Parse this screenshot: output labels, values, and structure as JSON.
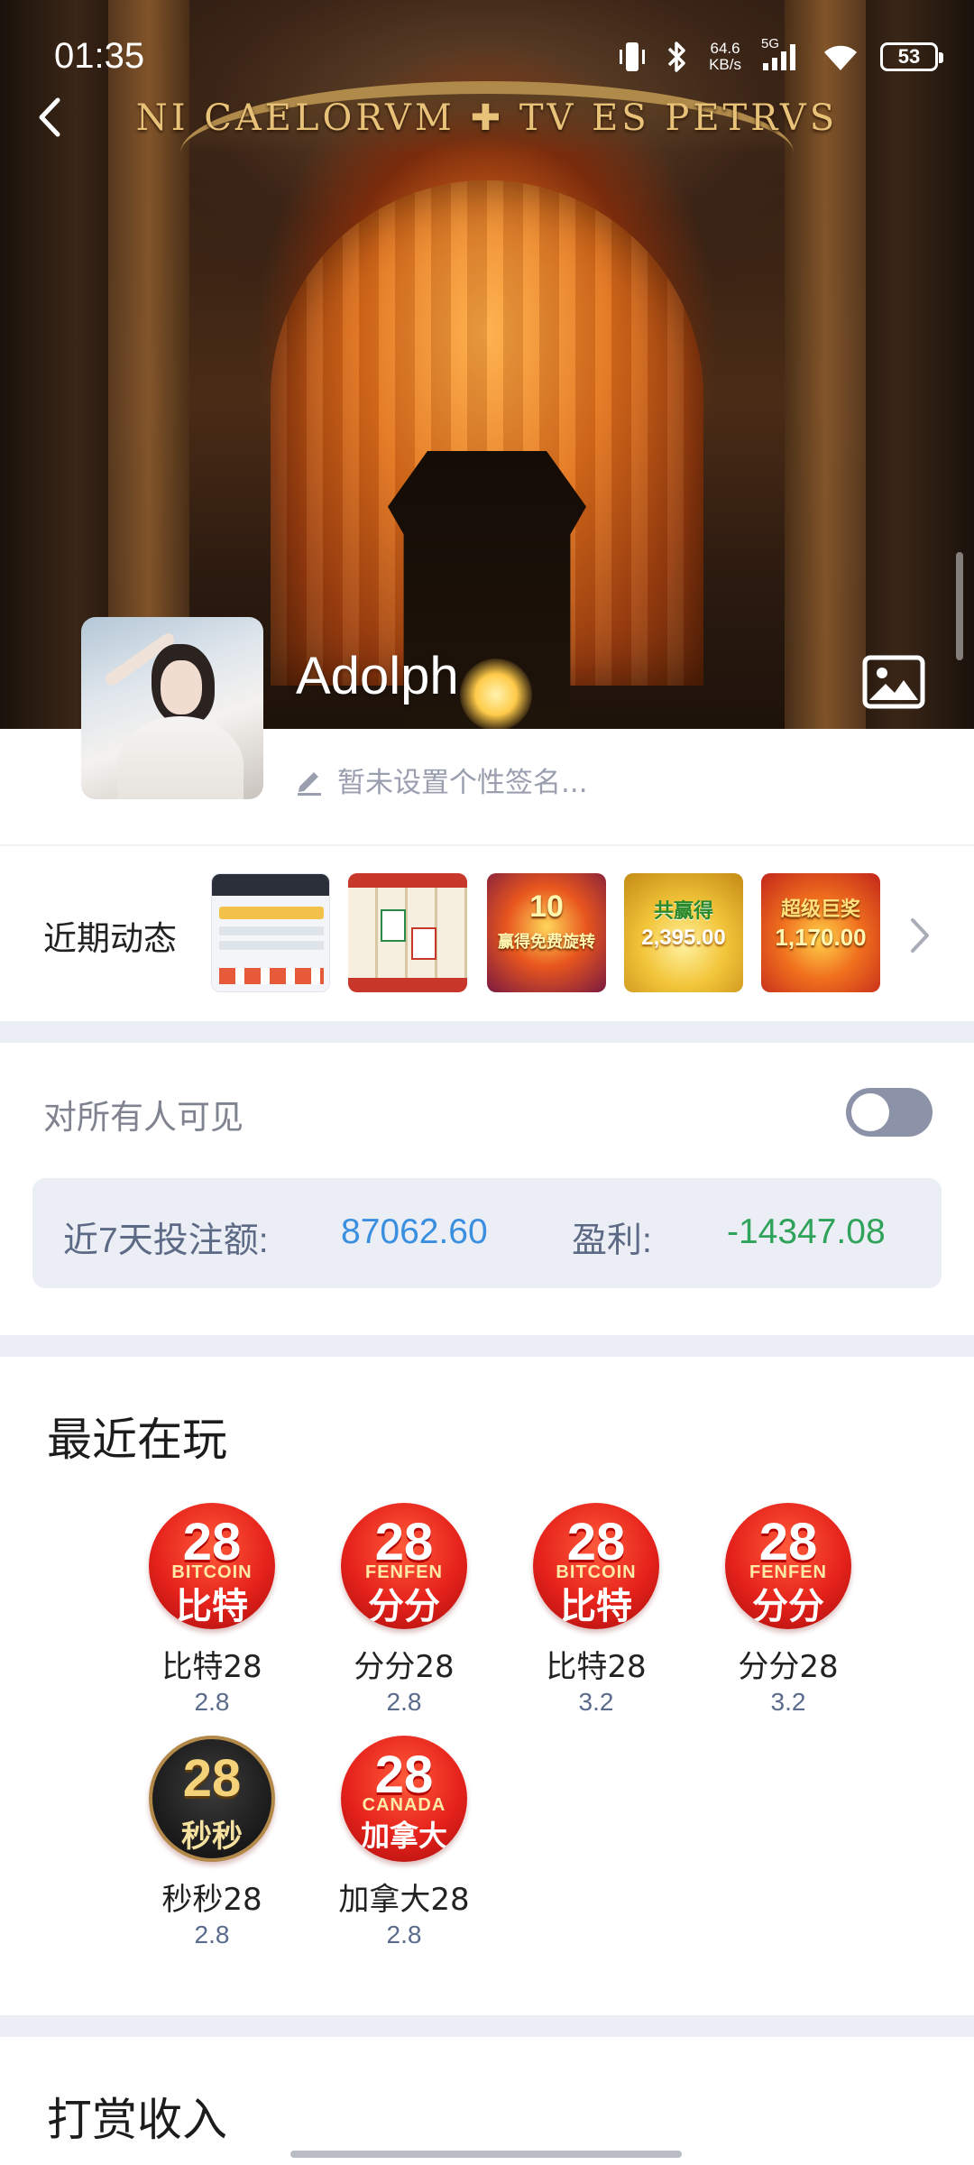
{
  "status_bar": {
    "time": "01:35",
    "net_speed_value": "64.6",
    "net_speed_unit": "KB/s",
    "network_type": "5G",
    "battery": "53"
  },
  "cover": {
    "inscription": "NI CAELORVM ✚ TV ES PETRVS"
  },
  "profile": {
    "username": "Adolph",
    "signature_placeholder": "暂未设置个性签名..."
  },
  "recent_activity": {
    "label": "近期动态",
    "thumbnails": [
      {
        "name": "screenshot"
      },
      {
        "name": "mahjong"
      },
      {
        "caption": "10",
        "sub": "赢得免费旋转"
      },
      {
        "caption": "共赢得",
        "sub": "2,395.00"
      },
      {
        "caption": "超级巨奖",
        "sub": "1,170.00"
      }
    ]
  },
  "visibility": {
    "label": "对所有人可见",
    "enabled": false
  },
  "stats": {
    "bet_label": "近7天投注额:",
    "bet_value": "87062.60",
    "profit_label": "盈利:",
    "profit_value": "-14347.08"
  },
  "recently_playing": {
    "title": "最近在玩",
    "games": [
      {
        "name": "比特28",
        "odds": "2.8",
        "logo_top": "28",
        "logo_mid": "BITCOIN",
        "logo_cn": "比特"
      },
      {
        "name": "分分28",
        "odds": "2.8",
        "logo_top": "28",
        "logo_mid": "FENFEN",
        "logo_cn": "分分"
      },
      {
        "name": "比特28",
        "odds": "3.2",
        "logo_top": "28",
        "logo_mid": "BITCOIN",
        "logo_cn": "比特"
      },
      {
        "name": "分分28",
        "odds": "3.2",
        "logo_top": "28",
        "logo_mid": "FENFEN",
        "logo_cn": "分分"
      },
      {
        "name": "秒秒28",
        "odds": "2.8",
        "logo_top": "28",
        "logo_mid": "",
        "logo_cn": "秒秒"
      },
      {
        "name": "加拿大28",
        "odds": "2.8",
        "logo_top": "28",
        "logo_mid": "CANADA",
        "logo_cn": "加拿大"
      }
    ]
  },
  "tips_income": {
    "title": "打赏收入"
  },
  "colors": {
    "bet_value": "#3a8fe0",
    "profit_value": "#2fa35a",
    "stats_label": "#5d6a85",
    "toggle_off": "#8c93a8"
  }
}
